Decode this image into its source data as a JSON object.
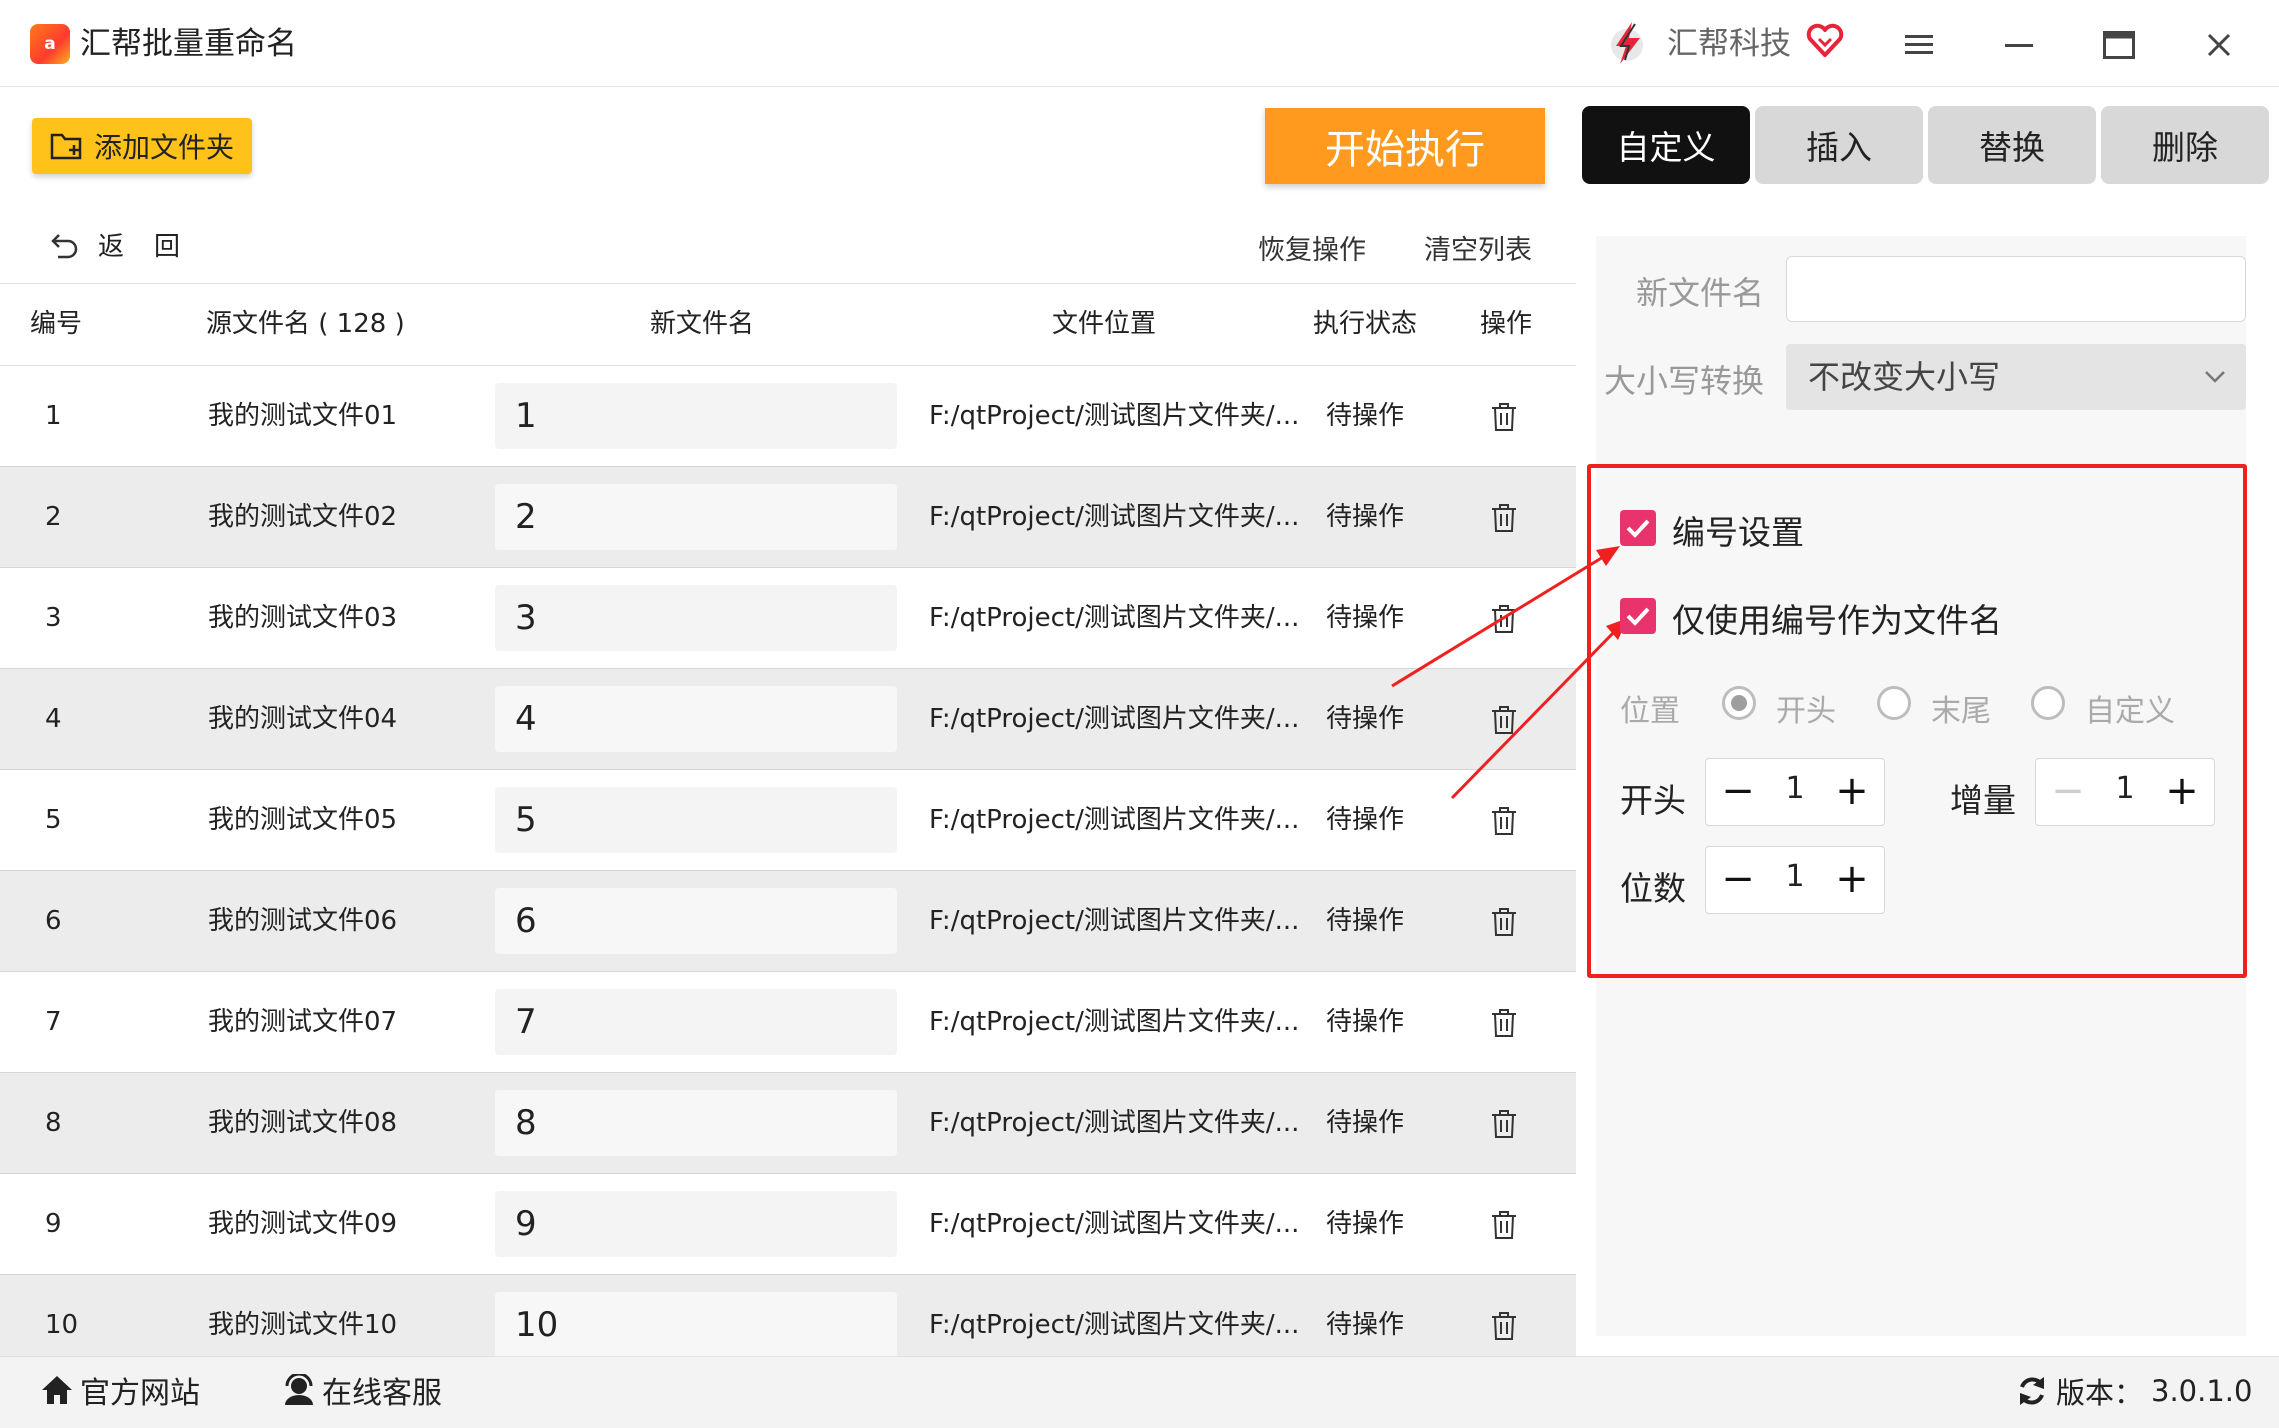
{
  "app": {
    "title": "汇帮批量重命名",
    "icon_text": "a",
    "brand_name": "汇帮科技"
  },
  "toolbar": {
    "add_folder_label": "添加文件夹",
    "start_label": "开始执行",
    "back_label": "返回",
    "restore_label": "恢复操作",
    "clear_label": "清空列表"
  },
  "tabs": [
    {
      "label": "自定义",
      "active": true
    },
    {
      "label": "插入",
      "active": false
    },
    {
      "label": "替换",
      "active": false
    },
    {
      "label": "删除",
      "active": false
    }
  ],
  "table": {
    "headers": {
      "index": "编号",
      "source": "源文件名 ( 128 )",
      "new_name": "新文件名",
      "location": "文件位置",
      "status": "执行状态",
      "action": "操作"
    },
    "rows": [
      {
        "index": "1",
        "source": "我的测试文件01",
        "new_name": "1",
        "location": "F:/qtProject/测试图片文件夹/...",
        "status": "待操作"
      },
      {
        "index": "2",
        "source": "我的测试文件02",
        "new_name": "2",
        "location": "F:/qtProject/测试图片文件夹/...",
        "status": "待操作"
      },
      {
        "index": "3",
        "source": "我的测试文件03",
        "new_name": "3",
        "location": "F:/qtProject/测试图片文件夹/...",
        "status": "待操作"
      },
      {
        "index": "4",
        "source": "我的测试文件04",
        "new_name": "4",
        "location": "F:/qtProject/测试图片文件夹/...",
        "status": "待操作"
      },
      {
        "index": "5",
        "source": "我的测试文件05",
        "new_name": "5",
        "location": "F:/qtProject/测试图片文件夹/...",
        "status": "待操作"
      },
      {
        "index": "6",
        "source": "我的测试文件06",
        "new_name": "6",
        "location": "F:/qtProject/测试图片文件夹/...",
        "status": "待操作"
      },
      {
        "index": "7",
        "source": "我的测试文件07",
        "new_name": "7",
        "location": "F:/qtProject/测试图片文件夹/...",
        "status": "待操作"
      },
      {
        "index": "8",
        "source": "我的测试文件08",
        "new_name": "8",
        "location": "F:/qtProject/测试图片文件夹/...",
        "status": "待操作"
      },
      {
        "index": "9",
        "source": "我的测试文件09",
        "new_name": "9",
        "location": "F:/qtProject/测试图片文件夹/...",
        "status": "待操作"
      },
      {
        "index": "10",
        "source": "我的测试文件10",
        "new_name": "10",
        "location": "F:/qtProject/测试图片文件夹/...",
        "status": "待操作"
      }
    ]
  },
  "panel": {
    "new_name_label": "新文件名",
    "new_name_value": "",
    "case_label": "大小写转换",
    "case_value": "不改变大小写",
    "numbering_label": "编号设置",
    "numbering_checked": true,
    "only_number_label": "仅使用编号作为文件名",
    "only_number_checked": true,
    "position_label": "位置",
    "position_options": [
      "开头",
      "末尾",
      "自定义"
    ],
    "position_selected": "开头",
    "start_label": "开头",
    "start_value": "1",
    "increment_label": "增量",
    "increment_value": "1",
    "digits_label": "位数",
    "digits_value": "1"
  },
  "status_bar": {
    "website_label": "官方网站",
    "support_label": "在线客服",
    "version_label": "版本：",
    "version_value": "3.0.1.0"
  },
  "colors": {
    "accent_orange": "#ff9a1f",
    "add_folder_yellow": "#ffc21a",
    "checkbox_pink": "#e8336d",
    "annotation_red": "#f02020",
    "active_tab": "#111111"
  }
}
